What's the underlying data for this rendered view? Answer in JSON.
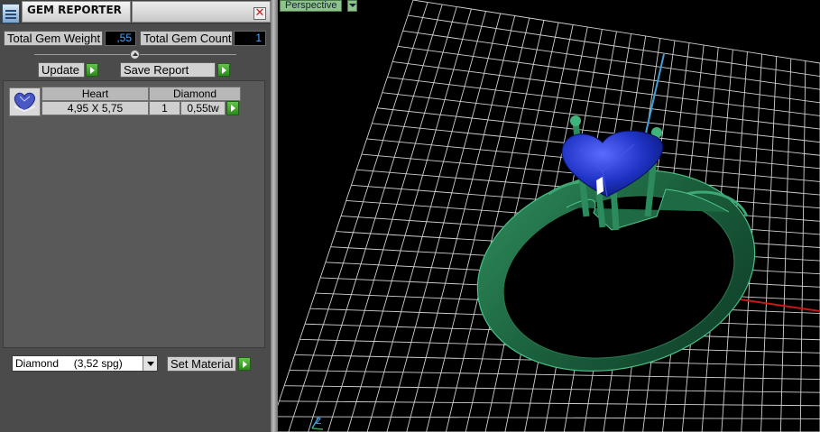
{
  "panel": {
    "title": "GEM REPORTER",
    "close_glyph": "✕",
    "total_weight_label": "Total Gem Weight",
    "total_weight_value": ",55",
    "total_count_label": "Total Gem Count",
    "total_count_value": "1",
    "update_label": "Update",
    "save_report_label": "Save Report",
    "gems": [
      {
        "cut": "Heart",
        "material": "Diamond",
        "size": "4,95 X 5,75",
        "count": "1",
        "weight": "0,55tw"
      }
    ],
    "material_select_value": "Diamond     (3,52 spg)",
    "set_material_label": "Set Material"
  },
  "viewport": {
    "view_mode_label": "Perspective",
    "gizmo_label": "Z"
  },
  "colors": {
    "ring_metal": "#1f6b45",
    "gem": "#2036c8",
    "grid": "#d0d0d0",
    "axis_z": "#3fa0d8",
    "axis_x": "#c81818",
    "value_text": "#4aa8ff"
  },
  "icons": {
    "app": "gem-reporter-app-icon",
    "close": "close-icon",
    "go": "green-arrow-icon",
    "dropdown": "chevron-down-icon",
    "slider": "slider-knob-icon",
    "thumbnail": "heart-gem-thumbnail"
  }
}
